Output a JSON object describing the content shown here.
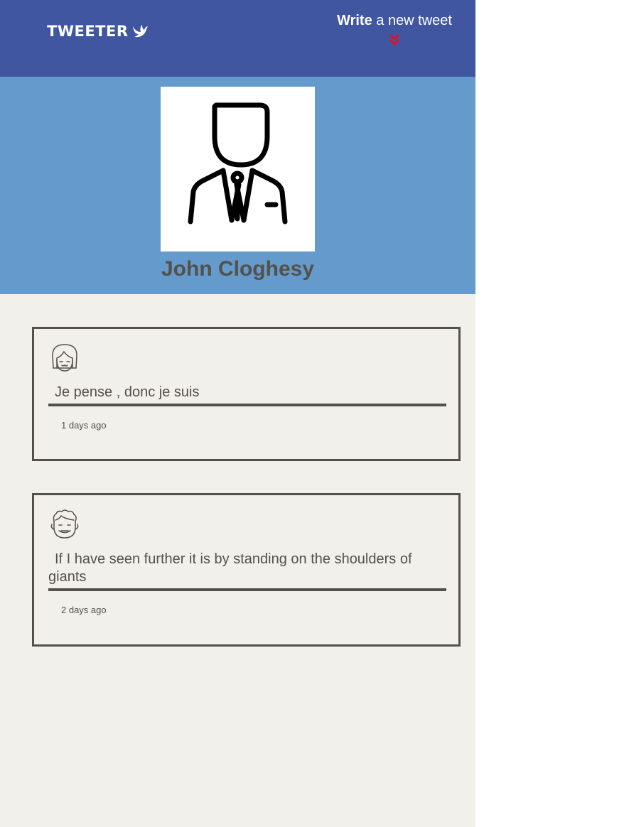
{
  "nav": {
    "brand": "TWEETER",
    "brand_icon": "dove-icon",
    "compose_bold": "Write",
    "compose_rest": " a new tweet",
    "compose_icon": "double-chevron-down-icon",
    "compose_icon_color": "#e0112b"
  },
  "profile": {
    "avatar_icon": "businessman-avatar-icon",
    "name": "John Cloghesy"
  },
  "colors": {
    "nav_bg": "#4056a1",
    "profile_bg": "#659acc",
    "page_bg": "#f2f0eb",
    "text": "#545149"
  },
  "tweets": [
    {
      "avatar_icon": "girl-face-icon",
      "text": "Je pense , donc je suis",
      "time": "1 days ago"
    },
    {
      "avatar_icon": "curly-hair-face-icon",
      "text": "If I have seen further it is by standing on the shoulders of giants",
      "time": "2 days ago"
    }
  ]
}
